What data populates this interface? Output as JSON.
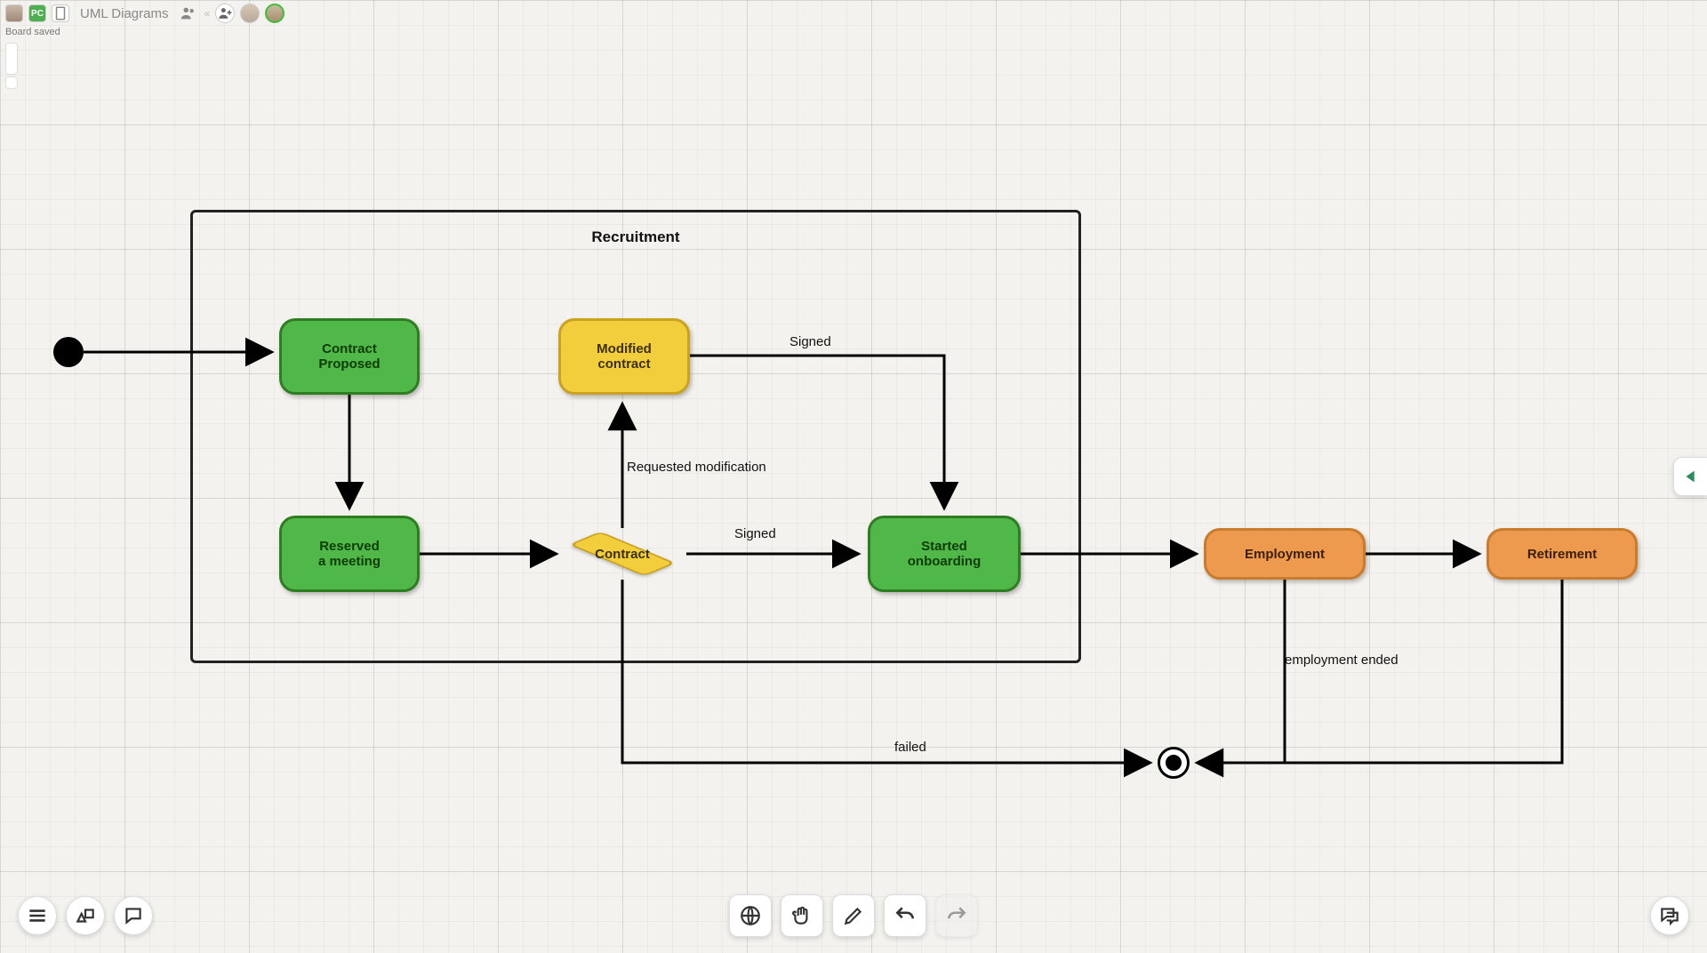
{
  "board": {
    "title": "UML Diagrams",
    "status": "Board saved",
    "pc_badge": "PC"
  },
  "diagram": {
    "frame_title": "Recruitment",
    "nodes": {
      "contract_proposed": "Contract\nProposed",
      "modified_contract": "Modified\ncontract",
      "reserved_meeting": "Reserved\na meeting",
      "contract": "Contract",
      "started_onboarding": "Started\nonboarding",
      "employment": "Employment",
      "retirement": "Retirement"
    },
    "edges": {
      "signed_top": "Signed",
      "requested_mod": "Requested modification",
      "signed_mid": "Signed",
      "failed": "failed",
      "employment_ended": "employment ended"
    }
  },
  "colors": {
    "green": "#50b848",
    "yellow": "#f3ce3c",
    "orange": "#ed9a4e",
    "frame": "#222222"
  }
}
